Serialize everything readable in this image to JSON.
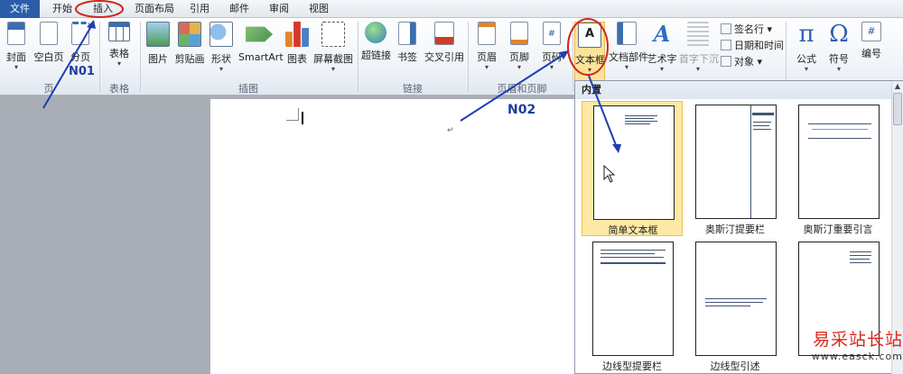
{
  "tabs": [
    "文件",
    "开始",
    "插入",
    "页面布局",
    "引用",
    "邮件",
    "审阅",
    "视图"
  ],
  "ribbon": {
    "pages_group": {
      "label": "页",
      "buttons": [
        "封面",
        "空白页",
        "分页"
      ]
    },
    "tables_group": {
      "label": "表格",
      "buttons": [
        "表格"
      ]
    },
    "illustrations_group": {
      "label": "插图",
      "buttons": [
        "图片",
        "剪贴画",
        "形状",
        "SmartArt",
        "图表",
        "屏幕截图"
      ]
    },
    "links_group": {
      "label": "链接",
      "buttons": [
        "超链接",
        "书签",
        "交叉引用"
      ]
    },
    "header_footer_group": {
      "label": "页眉和页脚",
      "buttons": [
        "页眉",
        "页脚",
        "页码"
      ]
    },
    "text_group": {
      "buttons": [
        "文本框",
        "文档部件",
        "艺术字",
        "首字下沉"
      ],
      "small_buttons": [
        "签名行",
        "日期和时间",
        "对象"
      ]
    },
    "symbols_group": {
      "buttons": [
        "公式",
        "符号",
        "编号"
      ]
    }
  },
  "annotations": {
    "no1": "N01",
    "no2": "N02"
  },
  "gallery": {
    "header": "内置",
    "items": [
      "简单文本框",
      "奥斯汀提要栏",
      "奥斯汀重要引言",
      "边线型提要栏",
      "边线型引述",
      ""
    ],
    "selected_index": 0
  },
  "watermark": {
    "cn": "易采站长站",
    "en": "www.easck.com"
  }
}
